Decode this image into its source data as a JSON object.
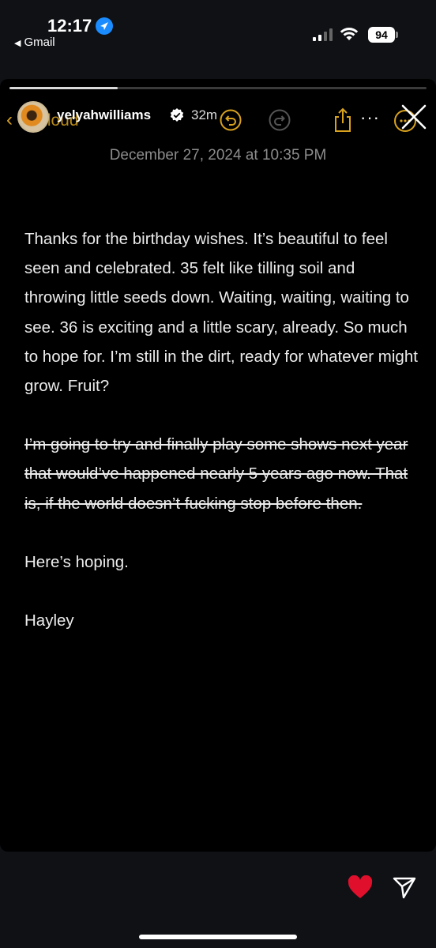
{
  "status_bar": {
    "time": "12:17",
    "back_app": "Gmail",
    "battery": "94"
  },
  "story": {
    "progress_fraction": 0.26,
    "notes_back_label": "iCloud",
    "username": "yelyahwilliams",
    "time_ago": "32m",
    "date": "December 27, 2024 at 10:35 PM",
    "paragraphs": [
      "Thanks for the birthday wishes. It’s beautiful to feel seen and celebrated. 35 felt like tilling soil and throwing little seeds down. Waiting, waiting, waiting to see. 36 is exciting and a little scary, already. So much to hope for. I’m still in the dirt, ready for whatever might grow. Fruit?",
      "I’m going to try and finally play some shows next year that would’ve happened nearly 5 years ago now. That is, if the world doesn’t fucking stop before then.",
      "Here’s hoping.",
      "Hayley"
    ]
  },
  "colors": {
    "accent": "#d8a21e",
    "heart": "#e0102c",
    "verified": "#ffffff"
  },
  "icons": [
    "location-icon",
    "signal-icon",
    "wifi-icon",
    "undo-icon",
    "redo-icon",
    "share-icon",
    "more-icon",
    "done-icon",
    "close-icon",
    "heart-icon",
    "send-icon"
  ]
}
